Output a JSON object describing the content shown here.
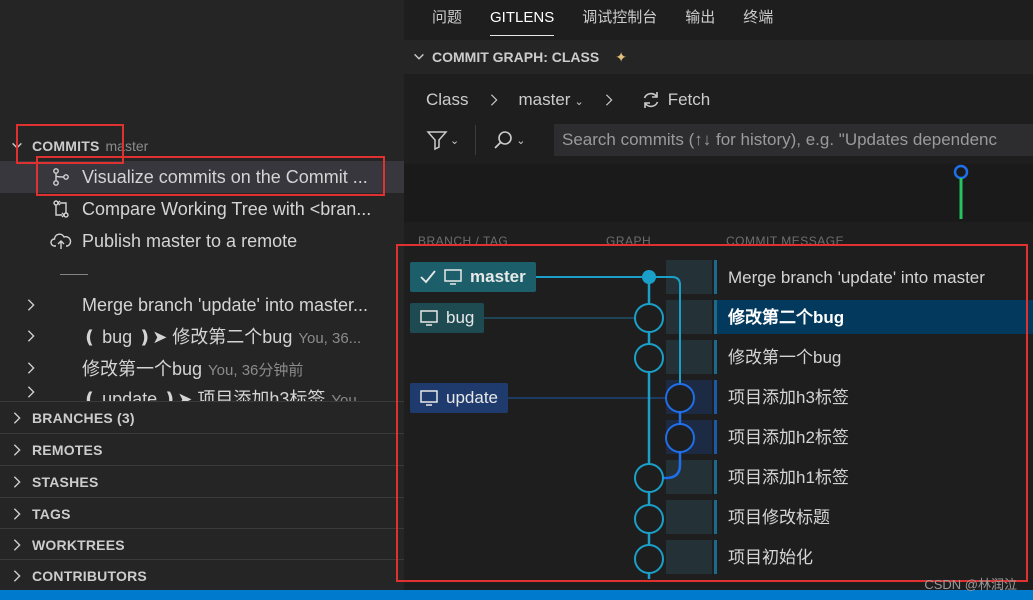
{
  "panel_tabs": [
    "问题",
    "GITLENS",
    "调试控制台",
    "输出",
    "终端"
  ],
  "view_title": "COMMIT GRAPH: CLASS",
  "toolbar": {
    "repo": "Class",
    "branch": "master",
    "fetch_label": "Fetch"
  },
  "search": {
    "placeholder": "Search commits (↑↓ for history), e.g. \"Updates dependenc"
  },
  "columns": {
    "branch_tag": "BRANCH / TAG",
    "graph": "GRAPH",
    "message": "COMMIT MESSAGE"
  },
  "sidebar": {
    "commits_label": "COMMITS",
    "commits_sub": "master",
    "actions": [
      {
        "label": "Visualize commits on the Commit ..."
      },
      {
        "label": "Compare Working Tree with <bran..."
      },
      {
        "label": "Publish master to a remote"
      }
    ],
    "divider_text": "——",
    "commits": [
      {
        "label": "Merge branch 'update' into master...",
        "meta": ""
      },
      {
        "tag": "❪ bug ❫➤",
        "label": "修改第二个bug",
        "meta": "You, 36..."
      },
      {
        "label": "修改第一个bug",
        "meta": "You, 36分钟前"
      },
      {
        "tag": "❪ update ❫➤",
        "label": "项目添加h3标签",
        "meta": "You..."
      }
    ],
    "sections": [
      "BRANCHES (3)",
      "REMOTES",
      "STASHES",
      "TAGS",
      "WORKTREES",
      "CONTRIBUTORS"
    ]
  },
  "graph": {
    "refs": {
      "master": "master",
      "bug": "bug",
      "update": "update"
    },
    "messages": [
      "Merge branch 'update' into master",
      "修改第二个bug",
      "修改第一个bug",
      "项目添加h3标签",
      "项目添加h2标签",
      "项目添加h1标签",
      "项目修改标题",
      "项目初始化"
    ]
  },
  "watermark": "CSDN @林润泣",
  "colors": {
    "accent": "#007acc",
    "highlight": "#e03131",
    "lane_master": "#1aa0c8",
    "lane_update": "#1f6feb"
  }
}
